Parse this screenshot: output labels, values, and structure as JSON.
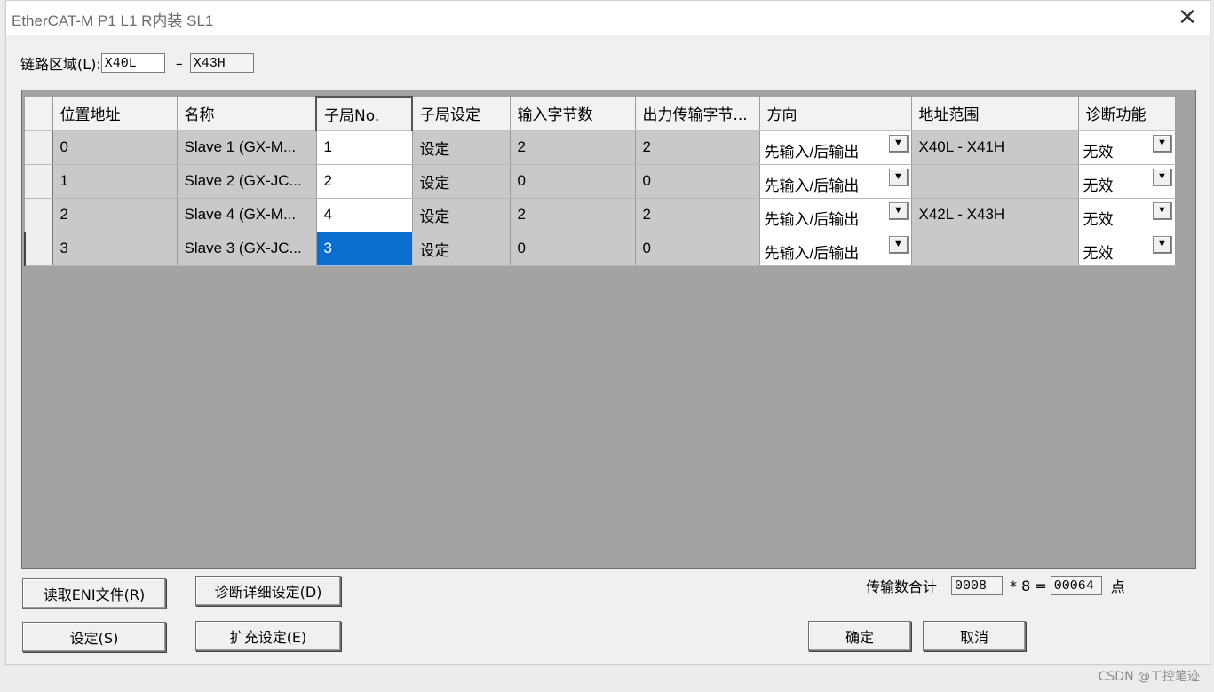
{
  "window": {
    "title": "EtherCAT-M  P1 L1 R内装 SL1",
    "close_glyph": "✕"
  },
  "link_area": {
    "label": "链路区域(L):",
    "from": "X40L",
    "separator": "–",
    "to": "X43H"
  },
  "table": {
    "headers": [
      "位置地址",
      "名称",
      "子局No.",
      "子局设定",
      "输入字节数",
      "出力传输字节...",
      "方向",
      "地址范围",
      "诊断功能"
    ],
    "rows": [
      {
        "pos": "0",
        "name": "Slave 1 (GX-M...",
        "no": "1",
        "setting": "设定",
        "in": "2",
        "out": "2",
        "dir": "先输入/后输出",
        "range": "X40L - X41H",
        "diag": "无效"
      },
      {
        "pos": "1",
        "name": "Slave 2 (GX-JC...",
        "no": "2",
        "setting": "设定",
        "in": "0",
        "out": "0",
        "dir": "先输入/后输出",
        "range": "",
        "diag": "无效"
      },
      {
        "pos": "2",
        "name": "Slave 4 (GX-M...",
        "no": "4",
        "setting": "设定",
        "in": "2",
        "out": "2",
        "dir": "先输入/后输出",
        "range": "X42L - X43H",
        "diag": "无效"
      },
      {
        "pos": "3",
        "name": "Slave 3 (GX-JC...",
        "no": "3",
        "setting": "设定",
        "in": "0",
        "out": "0",
        "dir": "先输入/后输出",
        "range": "",
        "diag": "无效"
      }
    ],
    "dropdown_glyph": "▼",
    "selection_color": "#0a6ed1"
  },
  "buttons": {
    "read_eni": "读取ENI文件(R)",
    "diag_detail": "诊断详细设定(D)",
    "settings": "设定(S)",
    "expand": "扩充设定(E)",
    "ok": "确定",
    "cancel": "取消"
  },
  "transfer": {
    "label": "传输数合计",
    "count": "0008",
    "op": "* 8 =",
    "total": "00064",
    "unit": "点"
  },
  "watermark": "CSDN @工控笔迹"
}
